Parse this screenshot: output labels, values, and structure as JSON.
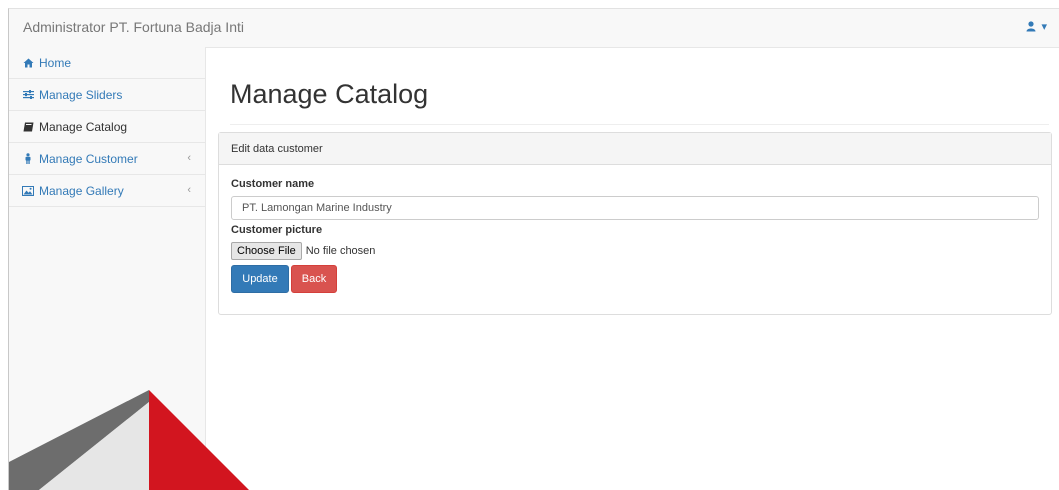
{
  "app": {
    "title": "Administrator PT. Fortuna Badja Inti",
    "user_caret": "▾"
  },
  "sidebar": {
    "items": [
      {
        "label": "Home",
        "icon": "home-icon"
      },
      {
        "label": "Manage Sliders",
        "icon": "sliders-icon"
      },
      {
        "label": "Manage Catalog",
        "icon": "book-icon"
      },
      {
        "label": "Manage Customer",
        "icon": "user-icon",
        "caret": "‹"
      },
      {
        "label": "Manage Gallery",
        "icon": "picture-icon",
        "caret": "‹"
      }
    ]
  },
  "main": {
    "page_title": "Manage Catalog",
    "panel": {
      "heading": "Edit data customer",
      "customer_name_label": "Customer name",
      "customer_name_value": "PT. Lamongan Marine Industry",
      "customer_picture_label": "Customer picture",
      "choose_file_label": "Choose File",
      "no_file_text": "No file chosen",
      "update_label": "Update",
      "back_label": "Back"
    }
  },
  "colors": {
    "link": "#337ab7",
    "primary": "#337ab7",
    "danger": "#d9534f",
    "watermark_red": "#d2151f",
    "watermark_gray": "#6d6d6d"
  }
}
